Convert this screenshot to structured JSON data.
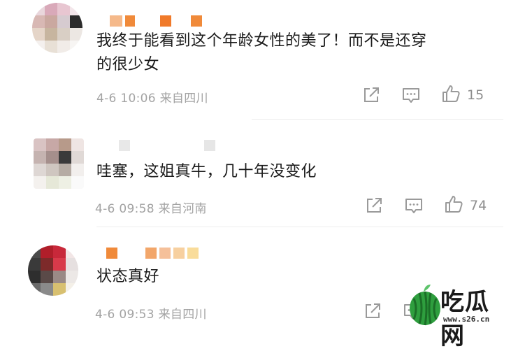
{
  "comments": [
    {
      "text": "我终于能看到这个年龄女性的美了！而不是还穿的很少女",
      "line1": "我终于能看到这个年龄女性的美了！而不是还穿",
      "line2": "的很少女",
      "timestamp": "4-6 10:06",
      "location": "来自四川",
      "likes": "15"
    },
    {
      "text": "哇塞，这姐真牛，几十年没变化",
      "timestamp": "4-6 09:58",
      "location": "来自河南",
      "likes": "74"
    },
    {
      "text": "状态真好",
      "timestamp": "4-6 09:53",
      "location": "来自四川",
      "likes": ""
    }
  ],
  "icons": {
    "share": "share-icon",
    "comment": "comment-icon",
    "like": "like-icon"
  },
  "watermark": {
    "text": "吃瓜网",
    "url": "www.s26.cn"
  },
  "colors": {
    "text": "#1a1a1a",
    "meta": "#a3a3a3",
    "icon": "#9a9a9a",
    "name_orange": "#f08a3a",
    "watermark_green": "#2e9e3e"
  }
}
